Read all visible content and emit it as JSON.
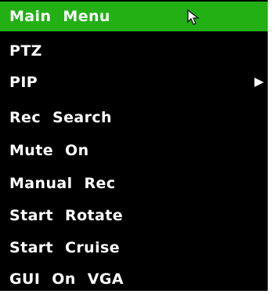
{
  "menu": {
    "items": [
      {
        "label": "Main Menu",
        "selected": true
      },
      {
        "label": "PTZ"
      },
      {
        "label": "PIP",
        "has_submenu": true
      },
      {
        "label": "Rec Search"
      },
      {
        "label": "Mute On"
      },
      {
        "label": "Manual Rec"
      },
      {
        "label": "Start Rotate"
      },
      {
        "label": "Start Cruise"
      },
      {
        "label": "GUI On VGA"
      }
    ]
  },
  "colors": {
    "selected_bg": "#22b015",
    "menu_bg": "#000000",
    "text": "#ffffff"
  },
  "icons": {
    "cursor": "mouse-pointer-icon",
    "submenu": "triangle-right-icon"
  }
}
